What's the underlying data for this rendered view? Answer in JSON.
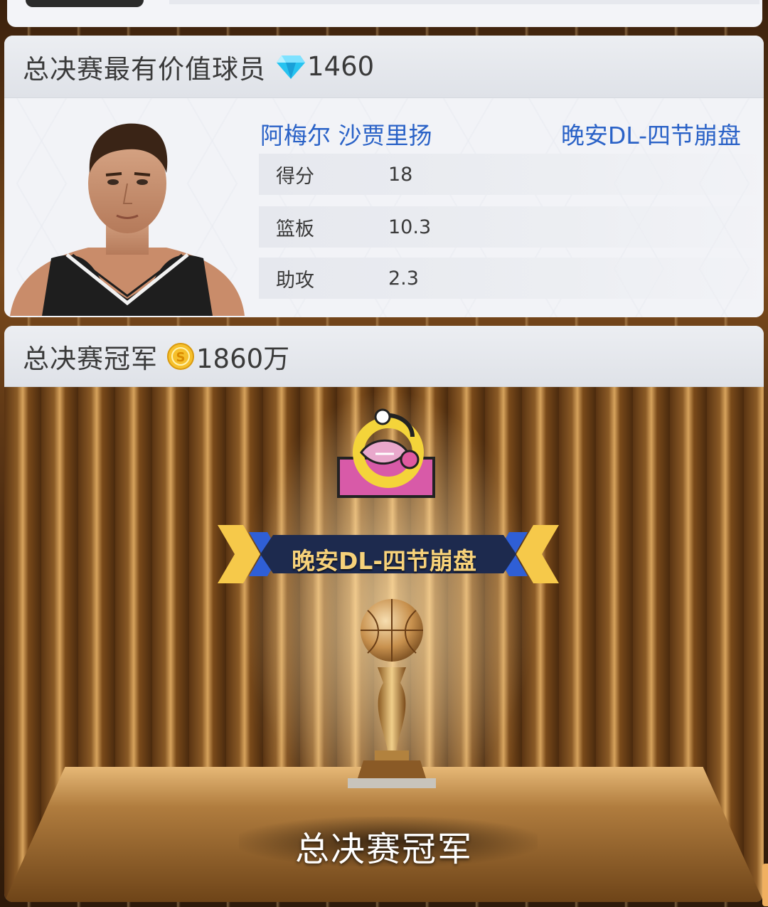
{
  "mvp": {
    "title": "总决赛最有价值球员",
    "reward_icon": "diamond-icon",
    "reward_value": "1460",
    "player_name": "阿梅尔 沙贾里扬",
    "team_name": "晚安DL-四节崩盘",
    "stats": [
      {
        "label": "得分",
        "value": "18"
      },
      {
        "label": "篮板",
        "value": "10.3"
      },
      {
        "label": "助攻",
        "value": "2.3"
      }
    ]
  },
  "champion": {
    "title": "总决赛冠军",
    "reward_icon": "coin-icon",
    "reward_value": "1860万",
    "team_name": "晚安DL-四节崩盘",
    "caption": "总决赛冠军"
  },
  "colors": {
    "link_blue": "#2a62c7",
    "banner_gold": "#f7d27a",
    "card_bg": "#f4f5f8"
  }
}
